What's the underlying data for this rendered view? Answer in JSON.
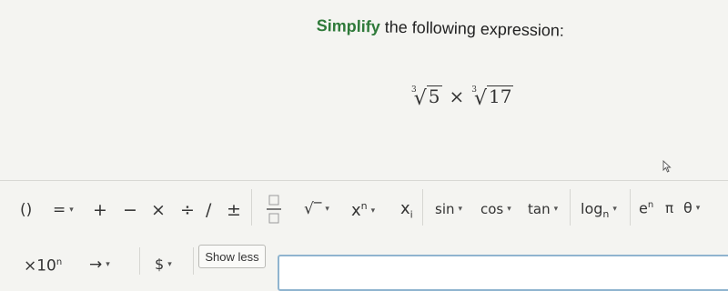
{
  "prompt": {
    "highlight": "Simplify",
    "rest": " the following expression:"
  },
  "expression": {
    "term1_index": "3",
    "term1_radicand": "5",
    "operator": "×",
    "term2_index": "3",
    "term2_radicand": "17"
  },
  "toolbar": {
    "row1": {
      "parentheses": "()",
      "equals": "=",
      "plus": "+",
      "minus": "−",
      "times": "×",
      "divide": "÷",
      "slash": "/",
      "plus_minus": "±",
      "sqrt": "√‾",
      "power_base": "x",
      "power_exp": "n",
      "subscript_base": "x",
      "subscript_sub": "i",
      "sin": "sin",
      "cos": "cos",
      "tan": "tan",
      "log": "log",
      "log_sub": "n",
      "exp_base": "e",
      "exp_exp": "n",
      "pi": "π",
      "theta": "θ"
    },
    "row2": {
      "sci_times": "×10",
      "sci_exp": "n",
      "arrow": "→",
      "dollar": "$"
    },
    "show_less_label": "Show less",
    "caret": "▾"
  },
  "colors": {
    "highlight": "#2f7a3a",
    "answer_border": "#8fb4cf"
  }
}
